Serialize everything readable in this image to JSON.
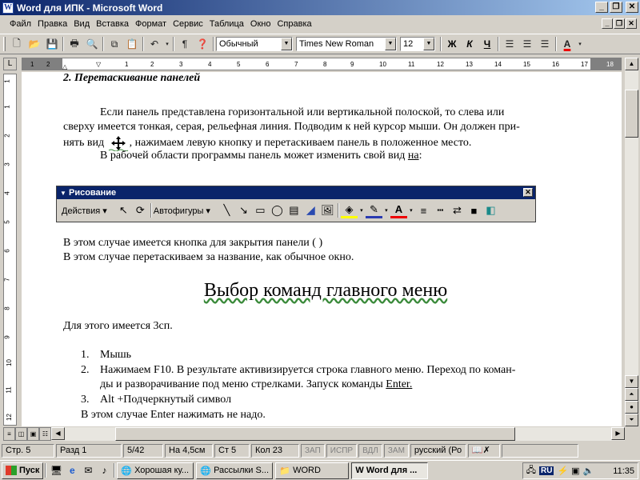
{
  "window": {
    "title": "Word для  ИПК - Microsoft Word",
    "app_icon": "W"
  },
  "menu": [
    "Файл",
    "Правка",
    "Вид",
    "Вставка",
    "Формат",
    "Сервис",
    "Таблица",
    "Окно",
    "Справка"
  ],
  "toolbar": {
    "style": "Обычный",
    "font": "Times New Roman",
    "size": "12",
    "bold": "Ж",
    "italic": "К",
    "underline": "Ч",
    "font_color_label": "A"
  },
  "ruler": {
    "ticks": [
      "1",
      "2",
      "1",
      "2",
      "3",
      "4",
      "5",
      "6",
      "7",
      "8",
      "9",
      "10",
      "11",
      "12",
      "13",
      "14",
      "15",
      "16",
      "17",
      "18"
    ],
    "vticks": [
      "1",
      "1",
      "2",
      "3",
      "4",
      "5",
      "6",
      "7",
      "8",
      "9",
      "10",
      "11",
      "12"
    ]
  },
  "doc": {
    "heading": "2. Перетаскивание панелей",
    "p1_l1": "Если панель представлена горизонтальной или вертикальной полоской, то слева или",
    "p1_l2": "сверху имеется тонкая, серая, рельефная линия. Подводим к ней курсор мыши. Он должен при-",
    "p1_l3a": "нять вид",
    "p1_l3b": ", нажимаем левую кнопку и перетаскиваем панель в положенное место.",
    "p2a": "В рабочей области программы панель может изменить свой вид ",
    "p2b": "на",
    "p2c": ":",
    "p3": "В этом случае имеется кнопка для закрытия панели (  )",
    "p4": "В этом случае перетаскиваем за название, как обычное окно.",
    "section_title": "Выбор команд главного меню",
    "p5": "Для этого имеется 3сп.",
    "list": [
      {
        "num": "1.",
        "text": "Мышь"
      },
      {
        "num": "2.",
        "text": "Нажимаем F10. В результате активизируется строка главного меню.  Переход по коман-"
      },
      {
        "num": "",
        "text": "ды и разворачивание под меню стрелками. Запуск команды "
      },
      {
        "num": "3.",
        "text": "Alt +Подчеркнутый символ"
      }
    ],
    "enter_word": "Enter.",
    "p6": "В этом случае Enter нажимать не надо."
  },
  "drawing_toolbar": {
    "title": "Рисование",
    "actions": "Действия ▾",
    "autoshapes": "Автофигуры ▾"
  },
  "status": {
    "page": "Стр.  5",
    "section": "Разд  1",
    "pages": "5/42",
    "at": "На 4,5см",
    "line": "Ст  5",
    "col": "Кол  23",
    "rec": "ЗАП",
    "trk": "ИСПР",
    "ext": "ВДЛ",
    "ovr": "ЗАМ",
    "lang": "русский (Ро"
  },
  "taskbar": {
    "start": "Пуск",
    "tasks": [
      "Хорошая ку...",
      "Рассылки S...",
      "WORD",
      "Word для ..."
    ],
    "lang": "RU",
    "clock": "11:35"
  }
}
